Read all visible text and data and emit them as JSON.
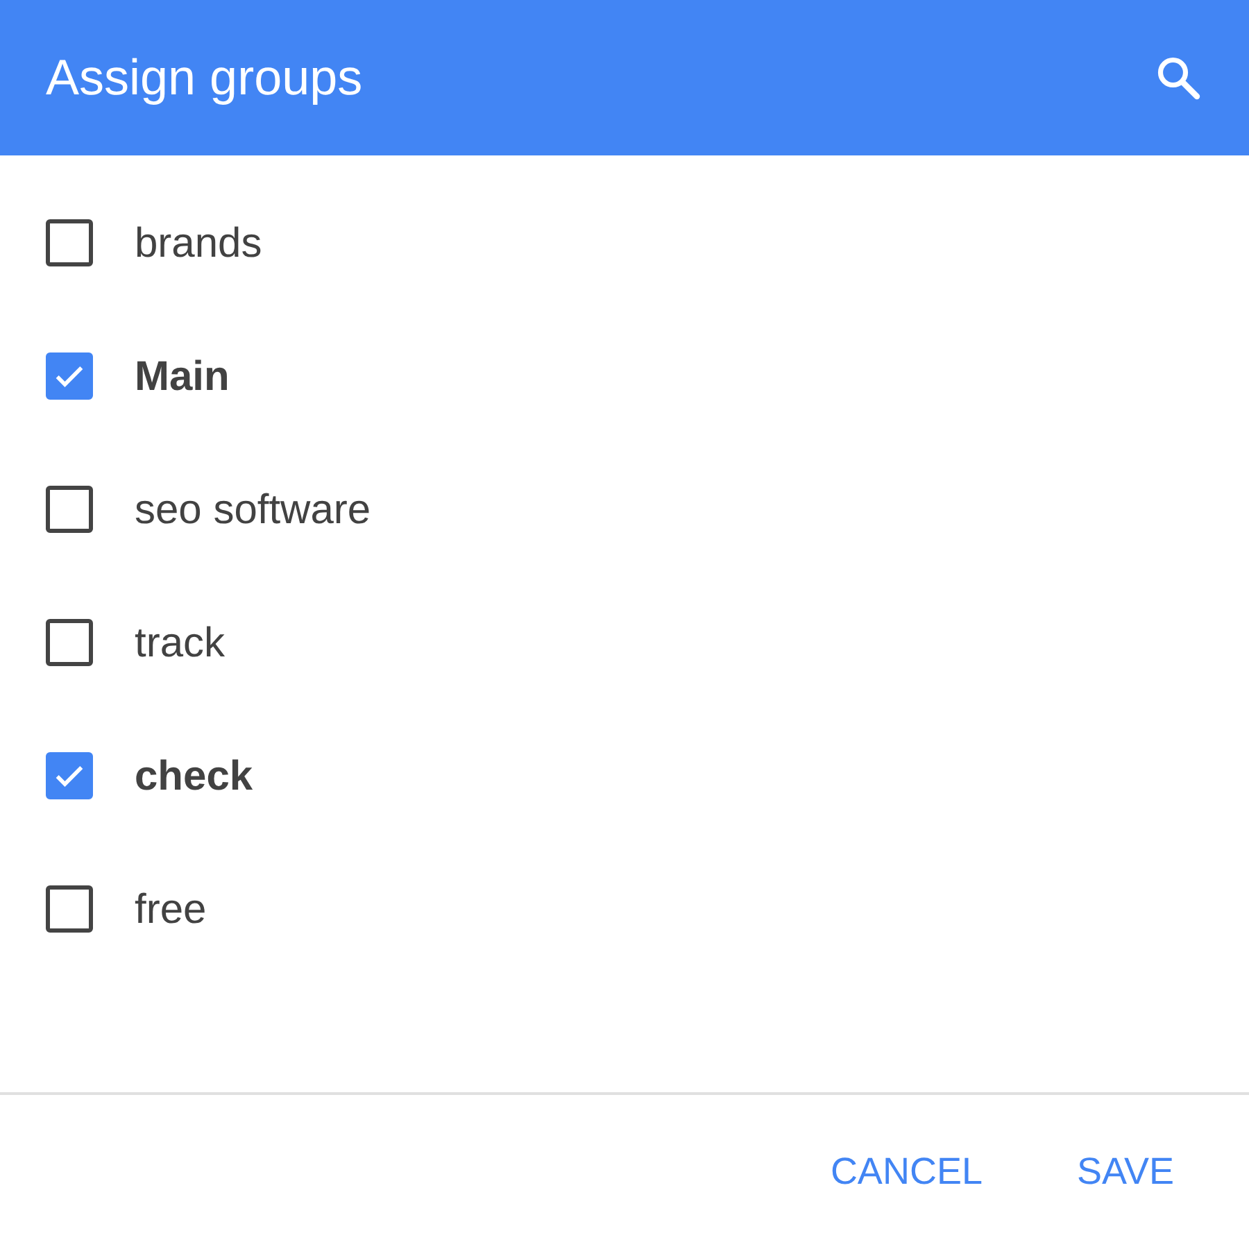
{
  "header": {
    "title": "Assign groups"
  },
  "groups": [
    {
      "label": "brands",
      "checked": false
    },
    {
      "label": "Main",
      "checked": true
    },
    {
      "label": "seo software",
      "checked": false
    },
    {
      "label": "track",
      "checked": false
    },
    {
      "label": "check",
      "checked": true
    },
    {
      "label": "free",
      "checked": false
    }
  ],
  "buttons": [
    "CANCEL",
    "SAVE"
  ]
}
